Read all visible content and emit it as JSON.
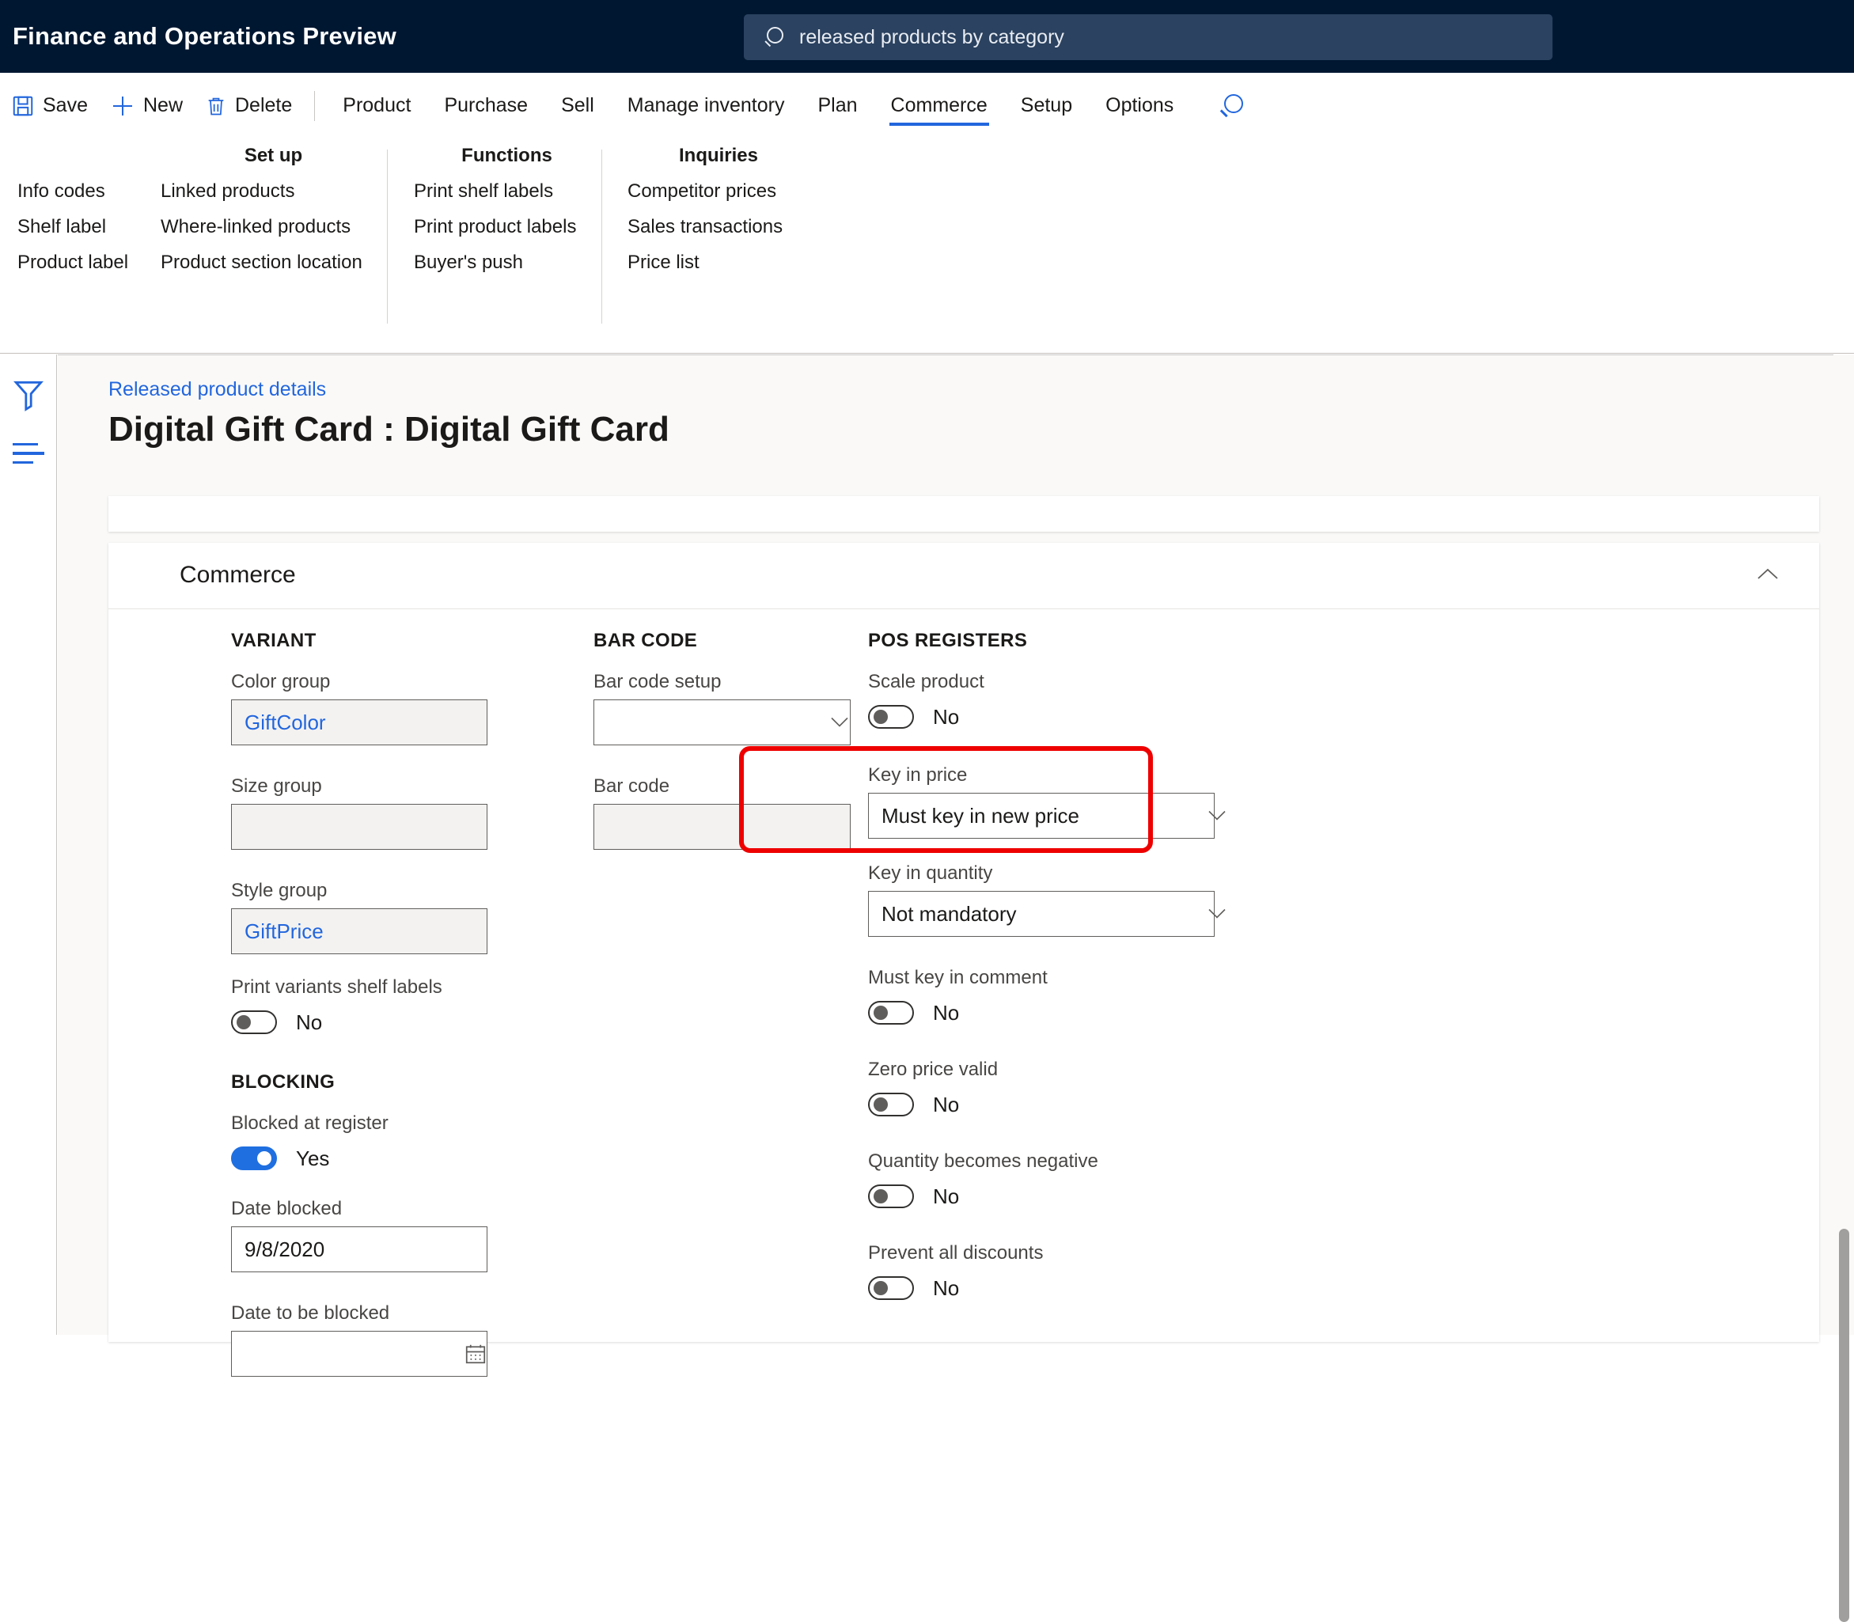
{
  "header": {
    "app_title": "Finance and Operations Preview",
    "search": {
      "value": "released products by category",
      "icon": "search-icon"
    },
    "colors": {
      "bar_bg": "#001731",
      "search_bg": "#2b4260"
    }
  },
  "action_pane": {
    "buttons": [
      {
        "label": "Save",
        "icon": "save-icon"
      },
      {
        "label": "New",
        "icon": "plus-icon"
      },
      {
        "label": "Delete",
        "icon": "trash-icon"
      }
    ],
    "tabs": [
      {
        "label": "Product",
        "active": false
      },
      {
        "label": "Purchase",
        "active": false
      },
      {
        "label": "Sell",
        "active": false
      },
      {
        "label": "Manage inventory",
        "active": false
      },
      {
        "label": "Plan",
        "active": false
      },
      {
        "label": "Commerce",
        "active": true
      },
      {
        "label": "Setup",
        "active": false
      },
      {
        "label": "Options",
        "active": false
      }
    ],
    "search_icon": "search-icon",
    "accent": "#2266dd"
  },
  "ribbon": {
    "loose_items": [
      "Info codes",
      "Shelf label",
      "Product label"
    ],
    "groups": [
      {
        "title": "Set up",
        "items": [
          "Linked products",
          "Where-linked products",
          "Product section location"
        ]
      },
      {
        "title": "Functions",
        "items": [
          "Print shelf labels",
          "Print product labels",
          "Buyer's push"
        ]
      },
      {
        "title": "Inquiries",
        "items": [
          "Competitor prices",
          "Sales transactions",
          "Price list"
        ]
      }
    ]
  },
  "left_rail": {
    "items": [
      {
        "icon": "filter-funnel-icon"
      },
      {
        "icon": "list-lines-icon"
      }
    ]
  },
  "page": {
    "breadcrumb": "Released product details",
    "title": "Digital Gift Card : Digital Gift Card"
  },
  "section": {
    "title": "Commerce",
    "collapse_icon": "chevron-up-icon"
  },
  "variant": {
    "heading": "VARIANT",
    "fields": [
      {
        "label": "Color group",
        "value": "GiftColor",
        "style": "link"
      },
      {
        "label": "Size group",
        "value": "",
        "style": "disabled"
      },
      {
        "label": "Style group",
        "value": "GiftPrice",
        "style": "link"
      }
    ],
    "toggle": {
      "label": "Print variants shelf labels",
      "state": "No",
      "on": false
    }
  },
  "blocking": {
    "heading": "BLOCKING",
    "toggle": {
      "label": "Blocked at register",
      "state": "Yes",
      "on": true
    },
    "date_blocked": {
      "label": "Date blocked",
      "value": "9/8/2020"
    },
    "date_to_be_blocked": {
      "label": "Date to be blocked",
      "value": "",
      "icon": "calendar-icon"
    }
  },
  "barcode": {
    "heading": "BAR CODE",
    "setup": {
      "label": "Bar code setup",
      "value": "",
      "icon": "chevron-down-icon"
    },
    "code": {
      "label": "Bar code",
      "value": ""
    }
  },
  "pos": {
    "heading": "POS REGISTERS",
    "scale_product": {
      "label": "Scale product",
      "state": "No",
      "on": false
    },
    "key_in_price": {
      "label": "Key in price",
      "value": "Must key in new price",
      "icon": "chevron-down-icon"
    },
    "key_in_quantity": {
      "label": "Key in quantity",
      "value": "Not mandatory",
      "icon": "chevron-down-icon"
    },
    "toggles": [
      {
        "label": "Must key in comment",
        "state": "No",
        "on": false
      },
      {
        "label": "Zero price valid",
        "state": "No",
        "on": false
      },
      {
        "label": "Quantity becomes negative",
        "state": "No",
        "on": false
      },
      {
        "label": "Prevent all discounts",
        "state": "No",
        "on": false
      }
    ]
  },
  "annotation": {
    "color": "#ee0000",
    "target": "key-in-price-dropdown"
  }
}
